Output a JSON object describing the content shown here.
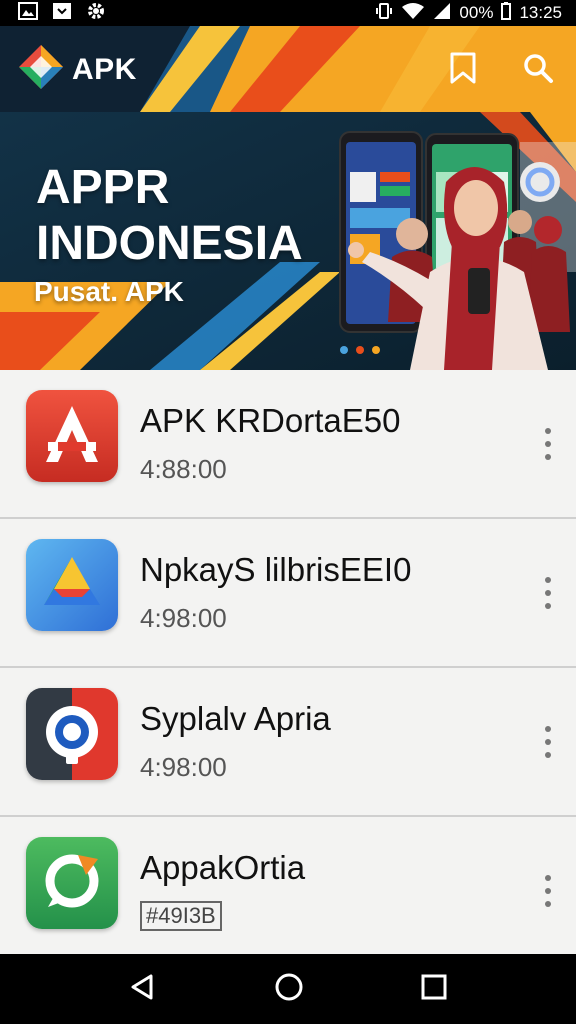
{
  "status_bar": {
    "battery": "00%",
    "time": "13:25"
  },
  "app_bar": {
    "brand": "APK",
    "bookmark_icon": "bookmark-icon",
    "search_icon": "search-icon"
  },
  "banner": {
    "title_line1": "APPR",
    "title_line2": "INDONESIA",
    "subtitle": "Pusat. APK"
  },
  "apps": [
    {
      "name": "APK KRDortaE50",
      "meta": "4:88:00",
      "icon": "app-a-icon"
    },
    {
      "name": "NpkayS lilbrisEEI0",
      "meta": "4:98:00",
      "icon": "drive-icon"
    },
    {
      "name": "Syplalv Apria",
      "meta": "4:98:00",
      "icon": "lens-icon"
    },
    {
      "name": "AppakOrtia",
      "meta": "#49I3B",
      "icon": "chat-refresh-icon"
    }
  ],
  "nav": {
    "back": "back-icon",
    "home": "home-icon",
    "recents": "recents-icon"
  },
  "colors": {
    "accent_orange": "#f5a623",
    "dark_navy": "#0f2233",
    "list_bg": "#f1f1f0"
  }
}
